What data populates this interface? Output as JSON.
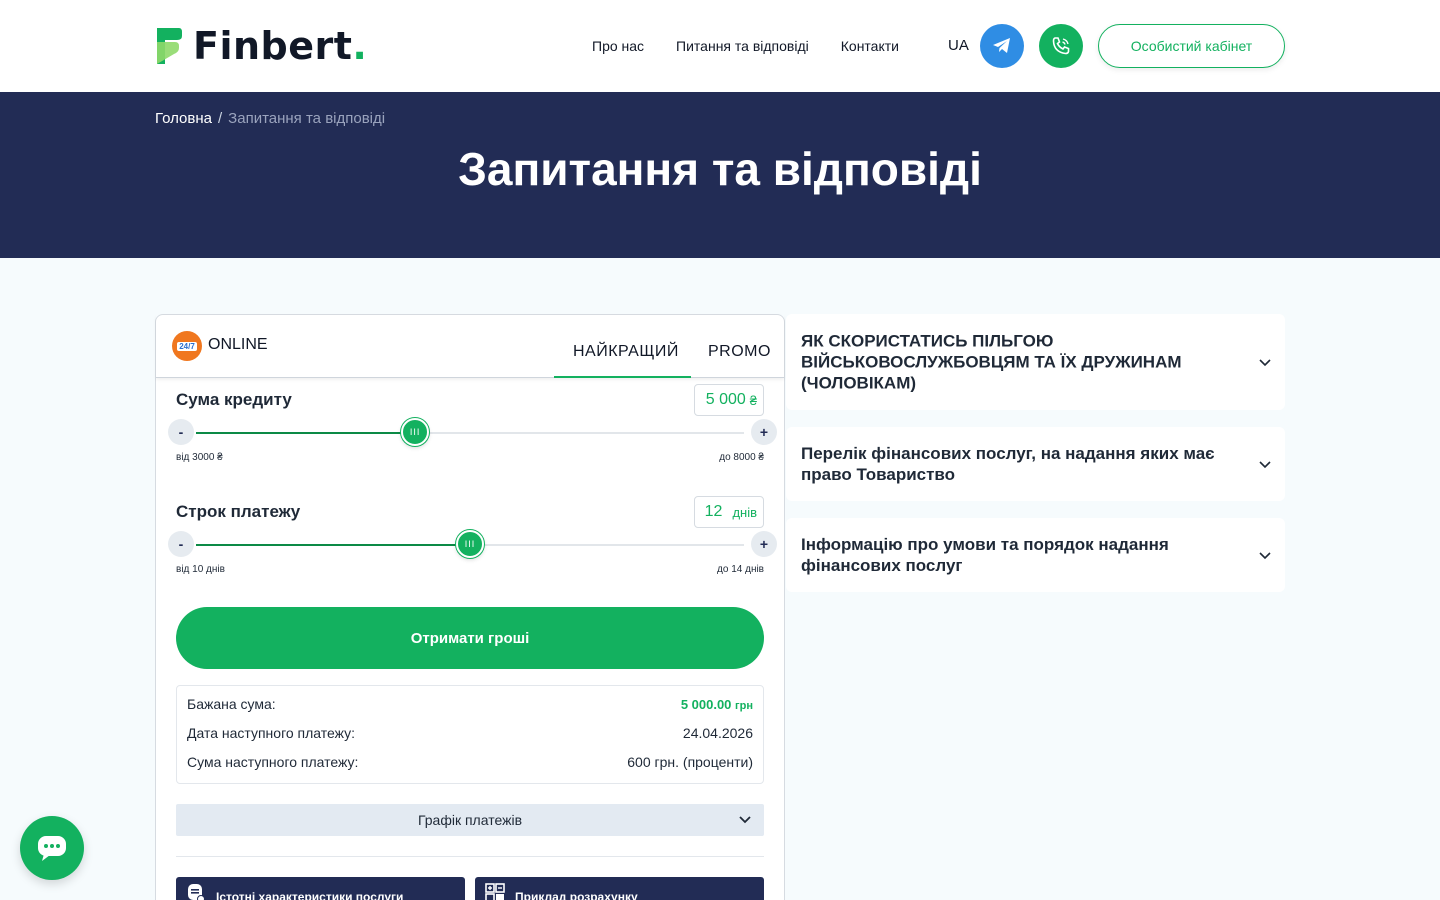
{
  "brand": {
    "name": "Finbert",
    "dot": ".",
    "accent": "#13b15f",
    "navy": "#222c55"
  },
  "nav": {
    "items": [
      "Про нас",
      "Питання та відповіді",
      "Контакти"
    ],
    "lang": "UA",
    "cabinet": "Особистий кабінет"
  },
  "hero": {
    "breadcrumb_home": "Головна",
    "breadcrumb_sep": "/",
    "breadcrumb_current": "Запитання та відповіді",
    "title": "Запитання та відповіді"
  },
  "calculator": {
    "badge": "24/7",
    "online": "ONLINE",
    "tabs": [
      "НАЙКРАЩИЙ",
      "PROMO"
    ],
    "active_tab": "НАЙКРАЩИЙ",
    "amount": {
      "label": "Сума кредиту",
      "value": "5 000",
      "unit": "₴",
      "min_label": "від 3000 ₴",
      "max_label": "до 8000 ₴",
      "level": 0.4,
      "minus": "-",
      "plus": "+"
    },
    "term": {
      "label": "Строк платежу",
      "value": "12",
      "unit": "днів",
      "min_label": "від 10 днів",
      "max_label": "до 14 днів",
      "level": 0.5,
      "minus": "-",
      "plus": "+"
    },
    "thumb_glyph": "III",
    "cta": "Отримати гроші",
    "summary": {
      "desired_label": "Бажана сума:",
      "desired_value": "5 000.00",
      "desired_unit": "грн",
      "next_date_label": "Дата наступного платежу:",
      "next_date_value": "24.04.2026",
      "next_sum_label": "Сума наступного платежу:",
      "next_sum_value": "600 грн. (проценти)"
    },
    "schedule": "Графік платежів",
    "info_buttons": [
      "Істотні характеристики послуги",
      "Приклад розрахунку"
    ]
  },
  "faq": [
    "ЯК СКОРИСТАТИСЬ ПІЛЬГОЮ ВІЙСЬКОВОСЛУЖБОВЦЯМ ТА ЇХ ДРУЖИНАМ (ЧОЛОВІКАМ)",
    "Перелік фінансових послуг, на надання яких має право Товариство",
    "Інформацію про умови та порядок надання фінансових послуг"
  ]
}
